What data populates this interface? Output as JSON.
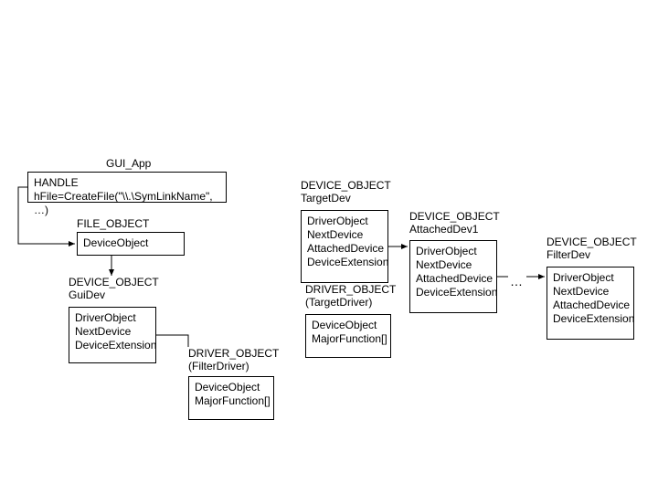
{
  "gui_app": {
    "title": "GUI_App",
    "code": "HANDLE hFile=CreateFile(\"\\\\.\\SymLinkName\", …)"
  },
  "file_object": {
    "title": "FILE_OBJECT",
    "field1": "DeviceObject"
  },
  "gui_dev": {
    "title_line1": "DEVICE_OBJECT",
    "title_line2": "GuiDev",
    "body": "DriverObject NextDevice DeviceExtension"
  },
  "filter_driver": {
    "title_line1": "DRIVER_OBJECT",
    "title_line2": "(FilterDriver)",
    "body": "DeviceObject MajorFunction[]"
  },
  "target_dev": {
    "title_line1": "DEVICE_OBJECT",
    "title_line2": "TargetDev",
    "body": "DriverObject NextDevice AttachedDevice DeviceExtension"
  },
  "target_driver": {
    "title_line1": "DRIVER_OBJECT",
    "title_line2": "(TargetDriver)",
    "body": "DeviceObject MajorFunction[]"
  },
  "attached_dev1": {
    "title_line1": "DEVICE_OBJECT",
    "title_line2": "AttachedDev1",
    "body": "DriverObject NextDevice AttachedDevice DeviceExtension"
  },
  "filter_dev": {
    "title_line1": "DEVICE_OBJECT",
    "title_line2": "FilterDev",
    "body": "DriverObject NextDevice AttachedDevice DeviceExtension"
  },
  "ellipsis": "…"
}
